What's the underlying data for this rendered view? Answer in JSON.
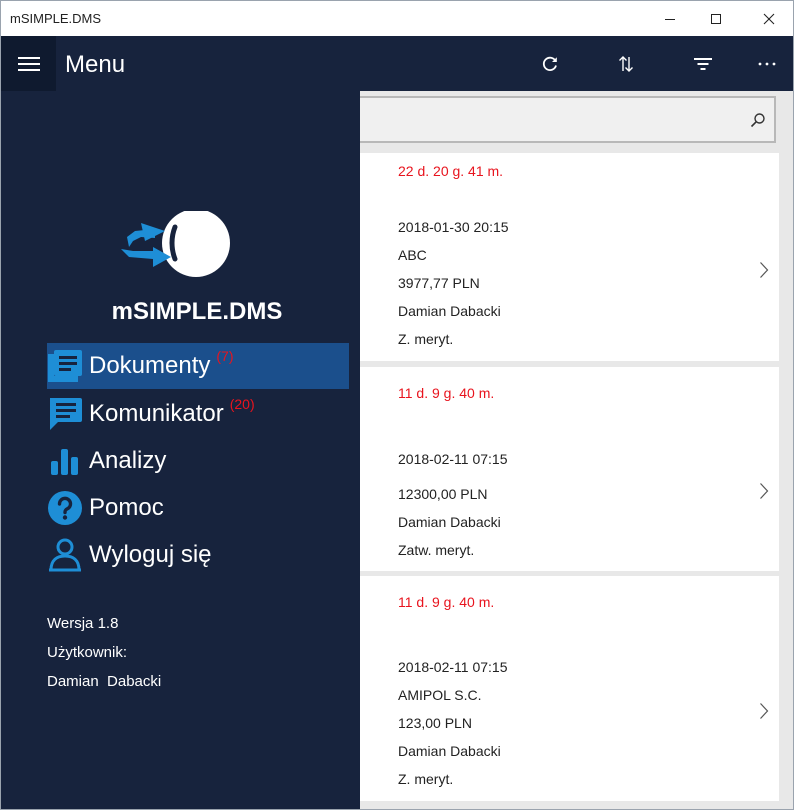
{
  "window": {
    "title": "mSIMPLE.DMS"
  },
  "appbar": {
    "menu_label": "Menu"
  },
  "brand": {
    "name": "mSIMPLE.DMS"
  },
  "nav": {
    "items": [
      {
        "label": "Dokumenty",
        "count": "(7)",
        "icon": "document-list-icon",
        "active": true
      },
      {
        "label": "Komunikator",
        "count": "(20)",
        "icon": "chat-icon",
        "active": false
      },
      {
        "label": "Analizy",
        "count": "",
        "icon": "bar-chart-icon",
        "active": false
      },
      {
        "label": "Pomoc",
        "count": "",
        "icon": "help-icon",
        "active": false
      },
      {
        "label": "Wyloguj się",
        "count": "",
        "icon": "user-logout-icon",
        "active": false
      }
    ]
  },
  "info": {
    "version": "Wersja 1.8",
    "user_label": "Użytkownik:",
    "user_name": "Damian  Dabacki"
  },
  "search": {
    "value": "",
    "placeholder": ""
  },
  "documents": [
    {
      "deadline": "22 d. 20 g. 41 m.",
      "date": "2018-01-30 20:15",
      "contractor": "ABC",
      "amount": "3977,77 PLN",
      "person": "Damian Dabacki",
      "status": "Z. meryt."
    },
    {
      "deadline": "11 d. 9 g. 40 m.",
      "date": "2018-02-11 07:15",
      "contractor": "",
      "amount": "12300,00 PLN",
      "person": "Damian Dabacki",
      "status": "Zatw. meryt."
    },
    {
      "deadline": "11 d. 9 g. 40 m.",
      "date": "2018-02-11 07:15",
      "contractor": "AMIPOL S.C.",
      "amount": "123,00 PLN",
      "person": "Damian Dabacki",
      "status": "Z. meryt."
    }
  ],
  "colors": {
    "nav_bg": "#17233d",
    "active_bg": "#1b4f8c",
    "accent": "#1e8ed6",
    "deadline": "#e8141e"
  }
}
